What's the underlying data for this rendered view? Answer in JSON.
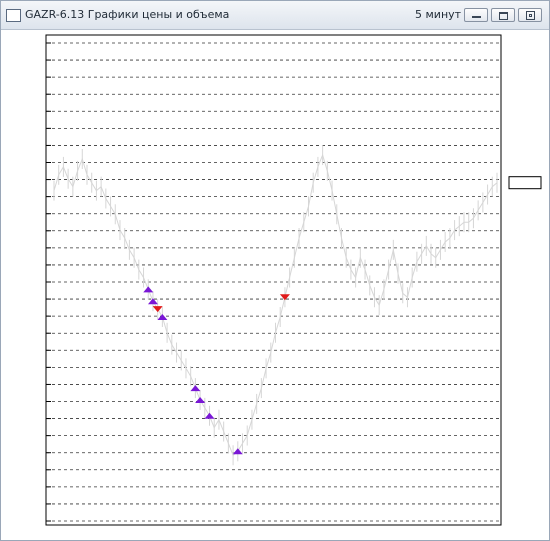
{
  "window": {
    "title": "GAZR-6.13 Графики цены и объема",
    "timeframe": "5 минут",
    "buttons": [
      "minimize-icon",
      "maximize-icon",
      "close-icon"
    ]
  },
  "colors": {
    "grid": "#333333",
    "price_line": "#d6d6d6",
    "buy_marker": "#7a17d6",
    "sell_marker": "#e01b1b",
    "frame": "#000000"
  },
  "chart_data": {
    "type": "line",
    "title": "",
    "xlabel": "",
    "ylabel": "",
    "grid": true,
    "y_axis_labels_visible": false,
    "relative_price_range": [
      0,
      100
    ],
    "series": [
      {
        "values": [
          72,
          76,
          78,
          75,
          73,
          77,
          80,
          76,
          74,
          72,
          73,
          70,
          68,
          66,
          62,
          60,
          57,
          55,
          52,
          50,
          47,
          44,
          42,
          40,
          36,
          33,
          31,
          29,
          27,
          25,
          22,
          19,
          17,
          15,
          12,
          14,
          11,
          8,
          5,
          6,
          8,
          10,
          14,
          18,
          22,
          27,
          31,
          36,
          40,
          45,
          50,
          55,
          60,
          64,
          68,
          74,
          78,
          81,
          77,
          72,
          66,
          60,
          55,
          52,
          50,
          55,
          52,
          48,
          45,
          43,
          47,
          52,
          57,
          51,
          46,
          45,
          50,
          54,
          56,
          58,
          56,
          55,
          57,
          59,
          60,
          62,
          63,
          64,
          64,
          65,
          67,
          69,
          71,
          73,
          74
        ],
        "markers": [
          {
            "index": 20,
            "type": "buy"
          },
          {
            "index": 21,
            "type": "buy"
          },
          {
            "index": 22,
            "type": "sell"
          },
          {
            "index": 23,
            "type": "buy"
          },
          {
            "index": 30,
            "type": "buy"
          },
          {
            "index": 31,
            "type": "buy"
          },
          {
            "index": 33,
            "type": "buy"
          },
          {
            "index": 39,
            "type": "buy"
          },
          {
            "index": 49,
            "type": "sell"
          }
        ]
      }
    ]
  }
}
